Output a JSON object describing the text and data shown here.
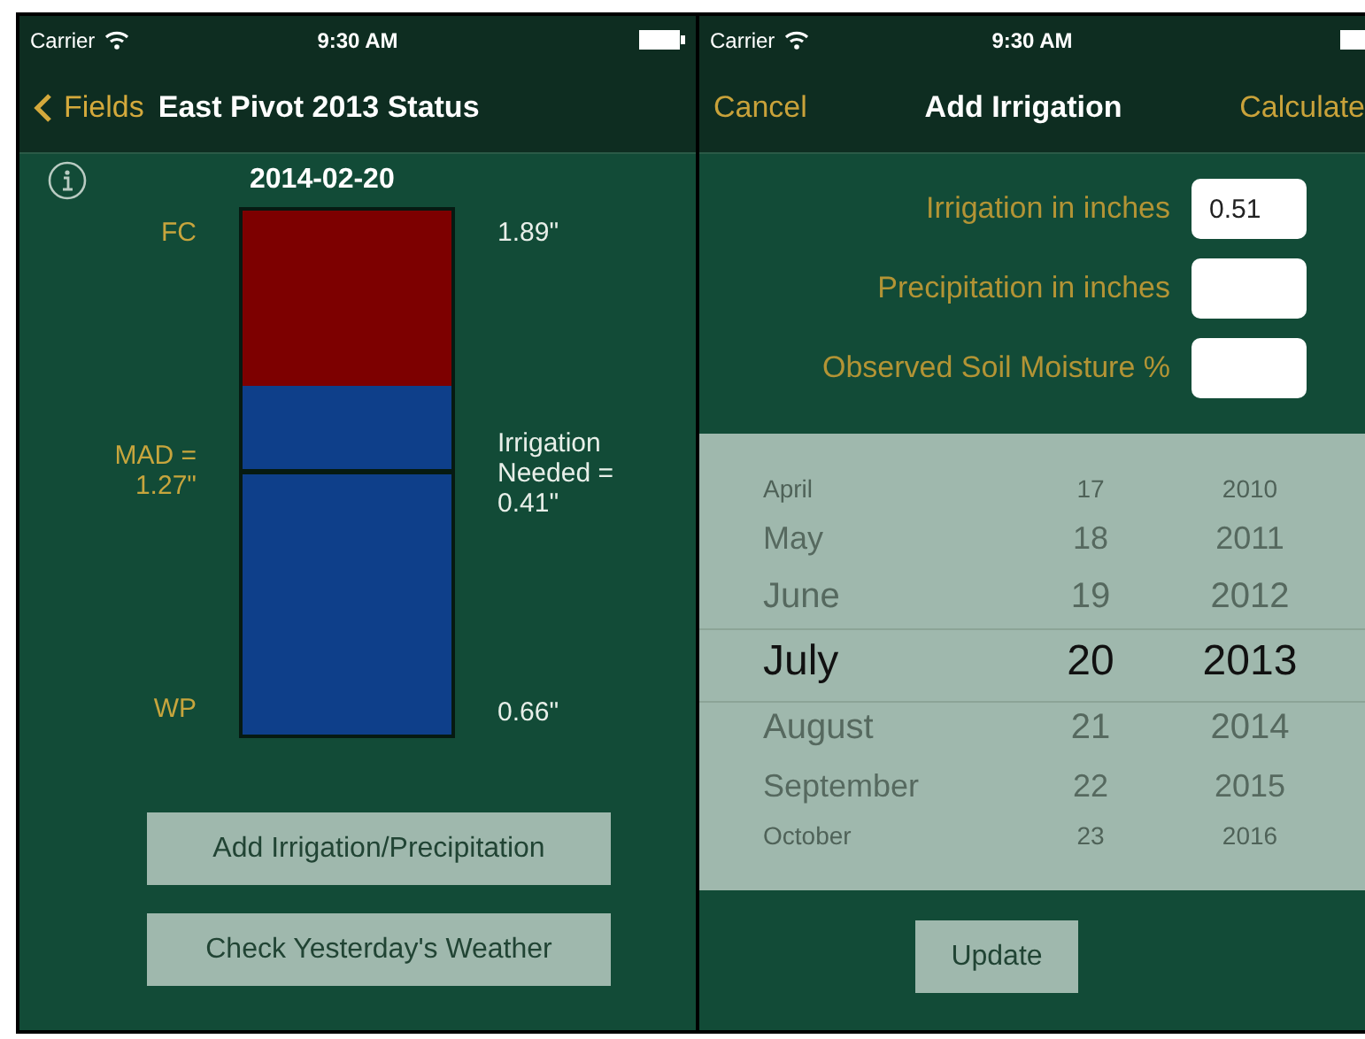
{
  "screens": [
    {
      "status_bar": {
        "carrier": "Carrier",
        "time": "9:30 AM"
      },
      "nav": {
        "back": "Fields",
        "title": "East Pivot 2013 Status"
      },
      "date": "2014-02-20",
      "gauge": {
        "level": 0.667,
        "markers": [
          {
            "level": 0.5
          }
        ],
        "left_labels": [
          "FC",
          "MAD =\n1.27\"",
          "WP"
        ],
        "right_labels": [
          "1.89\"",
          "Irrigation\nNeeded =\n0.41\"",
          "0.66\""
        ]
      },
      "buttons": [
        "Add Irrigation/Precipitation",
        "Check Yesterday's Weather"
      ]
    },
    {
      "status_bar": {
        "carrier": "Carrier",
        "time": "9:30 AM"
      },
      "nav": {
        "cancel": "Cancel",
        "title": "Add Irrigation",
        "action": "Calculate"
      },
      "fields": [
        {
          "label": "Irrigation in inches",
          "value": "0.51"
        },
        {
          "label": "Precipitation in inches"
        },
        {
          "label": "Observed Soil Moisture %"
        }
      ],
      "picker": {
        "columns": [
          {
            "items": [
              {
                "text": "April",
                "selected": false
              },
              {
                "text": "May",
                "selected": false
              },
              {
                "text": "June",
                "selected": false
              },
              {
                "text": "July",
                "selected": true
              },
              {
                "text": "August",
                "selected": false
              },
              {
                "text": "September",
                "selected": false
              },
              {
                "text": "October",
                "selected": false
              }
            ]
          },
          {
            "items": [
              {
                "text": "17",
                "selected": false
              },
              {
                "text": "18",
                "selected": false
              },
              {
                "text": "19",
                "selected": false
              },
              {
                "text": "20",
                "selected": true
              },
              {
                "text": "21",
                "selected": false
              },
              {
                "text": "22",
                "selected": false
              },
              {
                "text": "23",
                "selected": false
              }
            ]
          },
          {
            "items": [
              {
                "text": "2010",
                "selected": false
              },
              {
                "text": "2011",
                "selected": false
              },
              {
                "text": "2012",
                "selected": false
              },
              {
                "text": "2013",
                "selected": true
              },
              {
                "text": "2014",
                "selected": false
              },
              {
                "text": "2015",
                "selected": false
              },
              {
                "text": "2016",
                "selected": false
              }
            ]
          }
        ]
      },
      "button": "Update"
    }
  ]
}
